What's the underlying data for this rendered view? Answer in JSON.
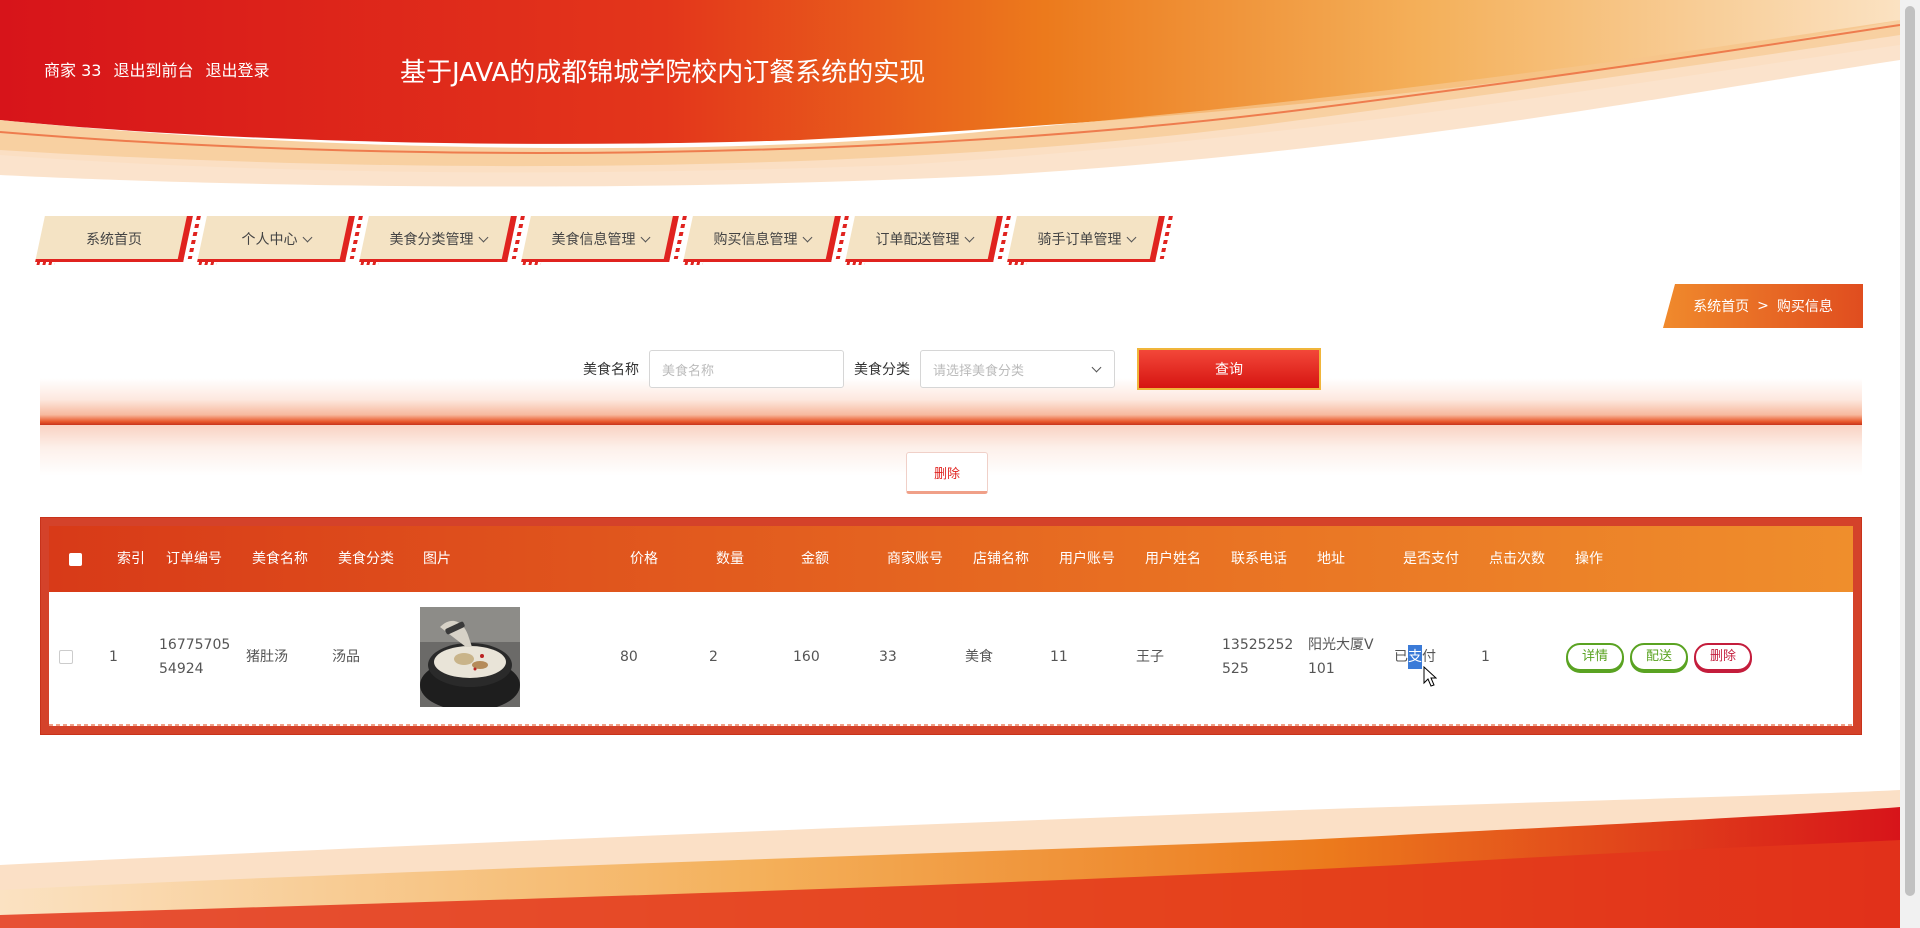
{
  "topbar": {
    "user": "商家 33",
    "to_front": "退出到前台",
    "logout": "退出登录"
  },
  "site_title": "基于JAVA的成都锦城学院校内订餐系统的实现",
  "nav": [
    {
      "label": "系统首页"
    },
    {
      "label": "个人中心"
    },
    {
      "label": "美食分类管理"
    },
    {
      "label": "美食信息管理"
    },
    {
      "label": "购买信息管理"
    },
    {
      "label": "订单配送管理"
    },
    {
      "label": "骑手订单管理"
    }
  ],
  "breadcrumb": {
    "home": "系统首页",
    "sep": ">",
    "current": "购买信息"
  },
  "search": {
    "food_name_label": "美食名称",
    "food_name_placeholder": "美食名称",
    "category_label": "美食分类",
    "category_placeholder": "请选择美食分类",
    "query_button": "查询"
  },
  "delete_button": "删除",
  "table": {
    "headers": {
      "index": "索引",
      "order_no": "订单编号",
      "food_name": "美食名称",
      "category": "美食分类",
      "image": "图片",
      "price": "价格",
      "quantity": "数量",
      "amount": "金额",
      "merchant_account": "商家账号",
      "shop_name": "店铺名称",
      "user_account": "用户账号",
      "user_name": "用户姓名",
      "phone": "联系电话",
      "address": "地址",
      "paid": "是否支付",
      "clicks": "点击次数",
      "actions": "操作"
    },
    "row": {
      "index": "1",
      "order_no": "16775705 54924",
      "food_name": "猪肚汤",
      "category": "汤品",
      "price": "80",
      "quantity": "2",
      "amount": "160",
      "merchant_account": "33",
      "shop_name": "美食",
      "user_account": "11",
      "user_name": "王子",
      "phone": "13525252 525",
      "address": "阳光大厦V 101",
      "paid_prefix": "已",
      "paid_highlight": "支",
      "paid_suffix": "付",
      "clicks": "1",
      "btn_detail": "详情",
      "btn_deliver": "配送",
      "btn_delete": "删除"
    }
  }
}
